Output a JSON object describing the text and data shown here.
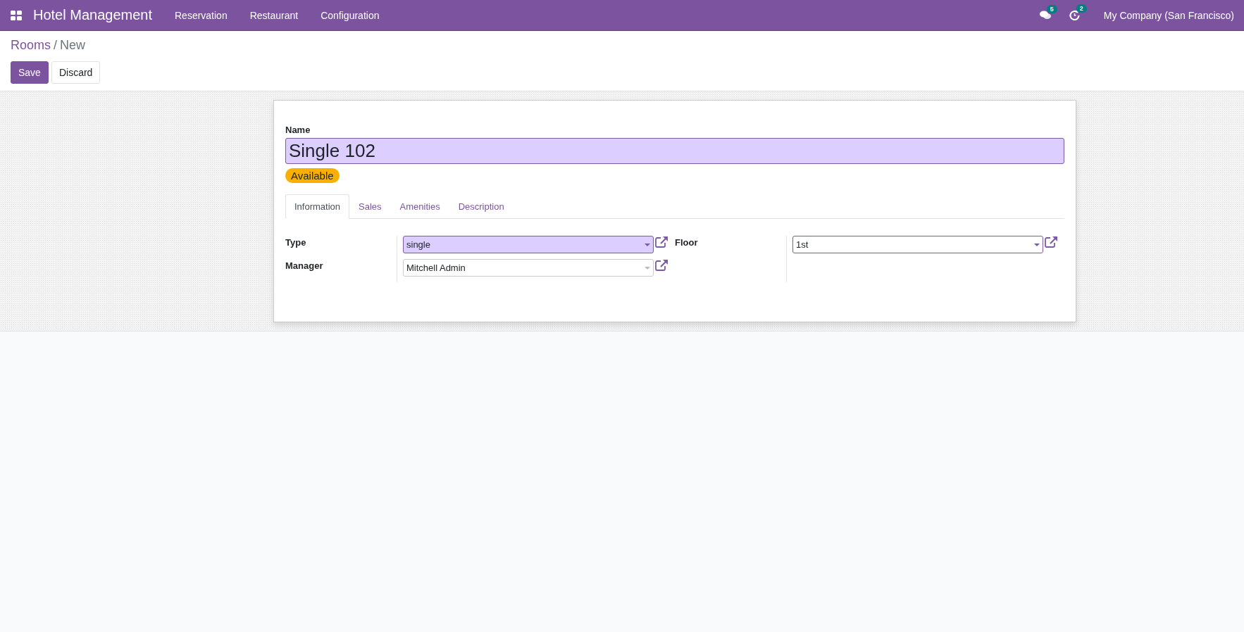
{
  "navbar": {
    "app_title": "Hotel Management",
    "menu": [
      "Reservation",
      "Restaurant",
      "Configuration"
    ],
    "messages_badge": "5",
    "activities_badge": "2",
    "company": "My Company (San Francisco)"
  },
  "breadcrumb": {
    "parent": "Rooms",
    "separator": "/",
    "current": "New"
  },
  "buttons": [
    {
      "label": "Save",
      "kind": "primary"
    },
    {
      "label": "Discard",
      "kind": "secondary"
    }
  ],
  "form": {
    "name_label": "Name",
    "name_value": "Single 102",
    "status": "Available",
    "tabs": [
      {
        "label": "Information",
        "selected": true
      },
      {
        "label": "Sales",
        "selected": false
      },
      {
        "label": "Amenities",
        "selected": false
      },
      {
        "label": "Description",
        "selected": false
      }
    ],
    "groups": [
      [
        {
          "label": "Type",
          "value": "single",
          "highlighted": true,
          "outlined": true
        },
        {
          "label": "Manager",
          "value": "Mitchell Admin",
          "highlighted": false,
          "outlined": false
        }
      ],
      [
        {
          "label": "Floor",
          "value": "1st",
          "highlighted": false,
          "outlined": true
        }
      ]
    ]
  }
}
